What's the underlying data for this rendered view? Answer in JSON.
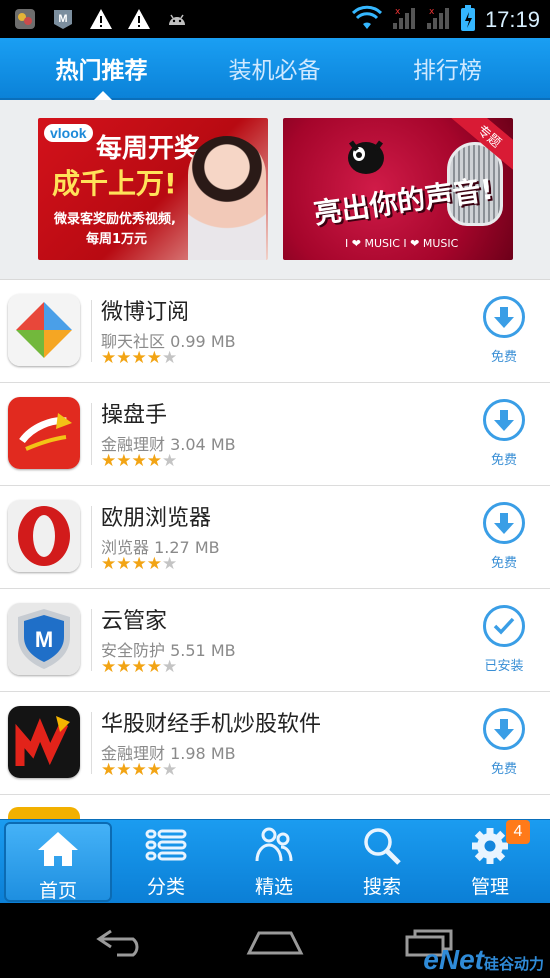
{
  "status_bar": {
    "time": "17:19"
  },
  "tabs": [
    {
      "label": "热门推荐",
      "active": true
    },
    {
      "label": "装机必备",
      "active": false
    },
    {
      "label": "排行榜",
      "active": false
    }
  ],
  "banners": {
    "left": {
      "logo": "vlook",
      "line1": "每周开奖",
      "line2": "成千上万!",
      "line3": "微录客奖励优秀视频,",
      "line4": "每周1万元"
    },
    "right": {
      "badge": "专题",
      "headline": "亮出你的声音!",
      "footer": "I ❤ MUSIC  I ❤ MUSIC"
    }
  },
  "apps": [
    {
      "name": "微博订阅",
      "category": "聊天社区",
      "size": "0.99 MB",
      "rating": 4,
      "action": "免费",
      "icon": "weibo-pinwheel-icon",
      "installed": false
    },
    {
      "name": "操盘手",
      "category": "金融理财",
      "size": "3.04 MB",
      "rating": 4,
      "action": "免费",
      "icon": "caopanshou-icon",
      "installed": false
    },
    {
      "name": "欧朋浏览器",
      "category": "浏览器",
      "size": "1.27 MB",
      "rating": 4,
      "action": "免费",
      "icon": "opera-icon",
      "installed": false
    },
    {
      "name": "云管家",
      "category": "安全防护",
      "size": "5.51 MB",
      "rating": 4,
      "action": "已安装",
      "icon": "mcafee-shield-icon",
      "installed": true
    },
    {
      "name": "华股财经手机炒股软件",
      "category": "金融理财",
      "size": "1.98 MB",
      "rating": 4,
      "action": "免费",
      "icon": "huagu-icon",
      "installed": false
    }
  ],
  "partial_row": {
    "name": ""
  },
  "bottom_nav": [
    {
      "label": "首页",
      "icon": "home-icon",
      "active": true
    },
    {
      "label": "分类",
      "icon": "list-icon",
      "active": false
    },
    {
      "label": "精选",
      "icon": "people-icon",
      "active": false
    },
    {
      "label": "搜索",
      "icon": "search-icon",
      "active": false
    },
    {
      "label": "管理",
      "icon": "gear-icon",
      "active": false,
      "badge": "4"
    }
  ],
  "watermark": {
    "brand": "eNet",
    "sub": "硅谷动力"
  },
  "colors": {
    "accent": "#1a9ff3",
    "star": "#f2a414",
    "action": "#3a9ee6"
  }
}
